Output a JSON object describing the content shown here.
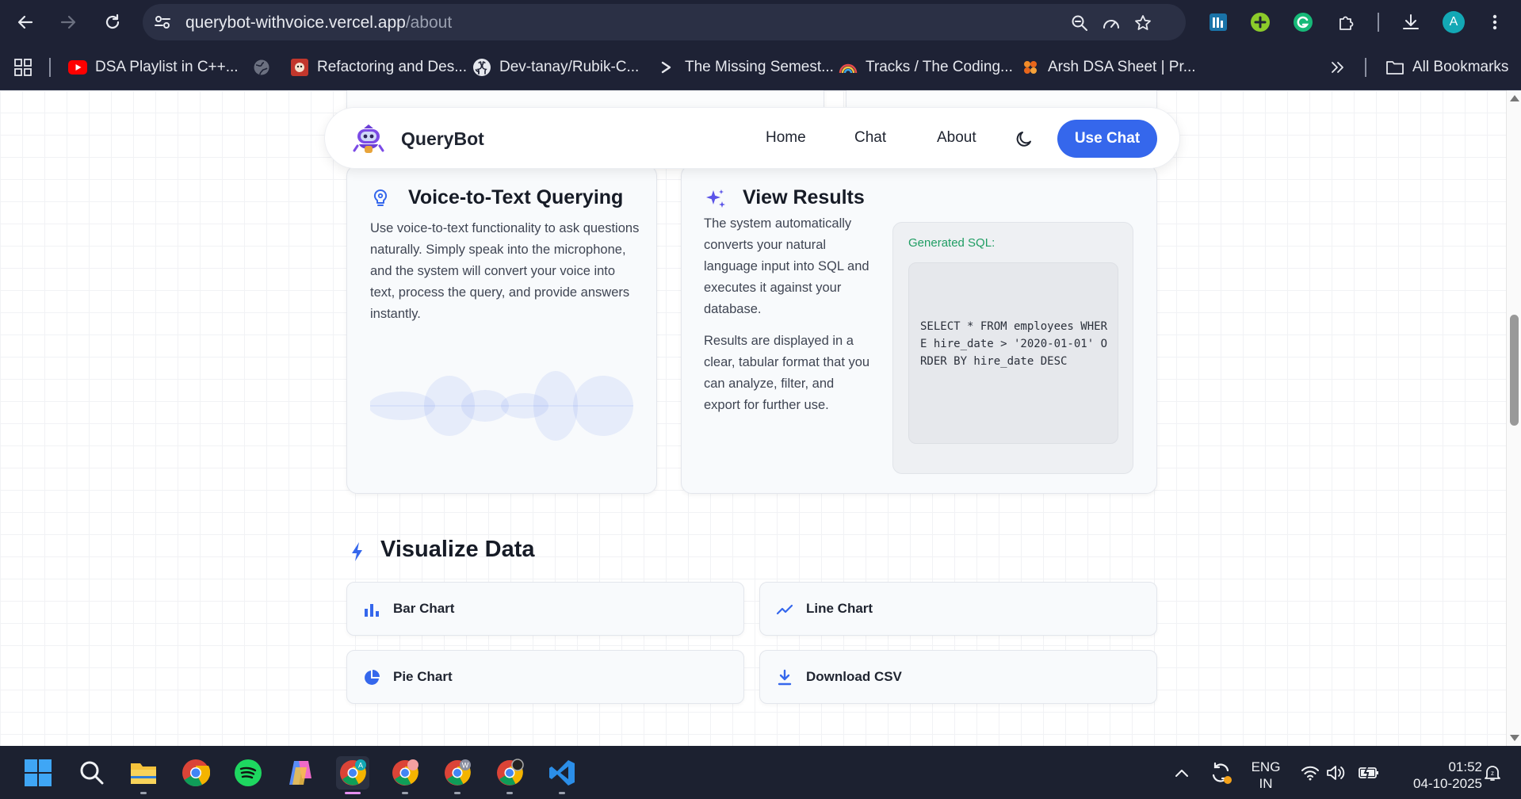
{
  "browser": {
    "url_host": "querybot-withvoice.vercel.app",
    "url_path": "/about",
    "profile_initial": "A",
    "bookmarks": [
      {
        "label": "DSA Playlist in C++..."
      },
      {
        "label": ""
      },
      {
        "label": "Refactoring and Des..."
      },
      {
        "label": "Dev-tanay/Rubik-C..."
      },
      {
        "label": "The Missing Semest..."
      },
      {
        "label": "Tracks / The Coding..."
      },
      {
        "label": "Arsh DSA Sheet | Pr..."
      }
    ],
    "all_bookmarks": "All Bookmarks"
  },
  "navbar": {
    "brand": "QueryBot",
    "links": [
      "Home",
      "Chat",
      "About"
    ],
    "cta": "Use Chat"
  },
  "voice_card": {
    "title": "Voice-to-Text Querying",
    "body": "Use voice-to-text functionality to ask questions naturally. Simply speak into the microphone, and the system will convert your voice into text, process the query, and provide answers instantly."
  },
  "results_card": {
    "title": "View Results",
    "para1": "The system automatically converts your natural language input into SQL and executes it against your database.",
    "para2": "Results are displayed in a clear, tabular format that you can analyze, filter, and export for further use.",
    "sql_label": "Generated SQL:",
    "sql_code": "SELECT * FROM employees WHERE hire_date > '2020-01-01' ORDER BY hire_date DESC"
  },
  "visualize": {
    "title": "Visualize Data",
    "options": [
      {
        "label": "Bar Chart",
        "icon": "bar-chart-icon"
      },
      {
        "label": "Line Chart",
        "icon": "line-chart-icon"
      },
      {
        "label": "Pie Chart",
        "icon": "pie-chart-icon"
      },
      {
        "label": "Download CSV",
        "icon": "download-icon"
      }
    ]
  },
  "taskbar": {
    "lang_line1": "ENG",
    "lang_line2": "IN",
    "time": "01:52",
    "date": "04-10-2025"
  },
  "colors": {
    "accent": "#3567ec",
    "sql_label": "#1f9d63",
    "browser_bg": "#1e2235"
  }
}
